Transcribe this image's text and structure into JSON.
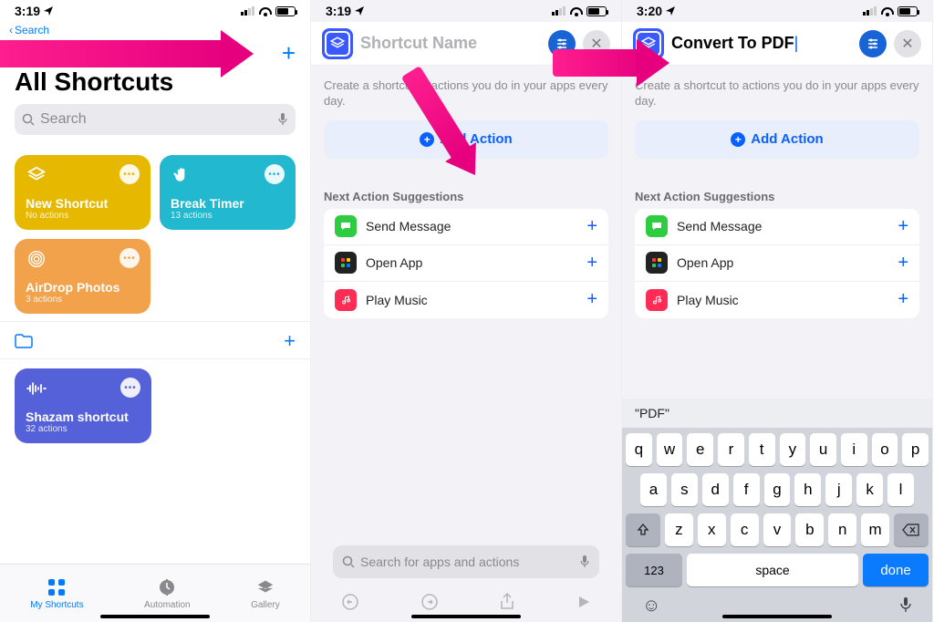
{
  "screens": {
    "s1": {
      "time": "3:19",
      "back": "Search",
      "title": "All Shortcuts",
      "searchPlaceholder": "Search",
      "tiles": [
        {
          "title": "New Shortcut",
          "sub": "No actions",
          "color": "#e6b800"
        },
        {
          "title": "Break Timer",
          "sub": "13 actions",
          "color": "#22b8cf"
        },
        {
          "title": "AirDrop Photos",
          "sub": "3 actions",
          "color": "#f2a24a"
        }
      ],
      "shazam": {
        "title": "Shazam shortcut",
        "sub": "32 actions",
        "color": "#5561d8"
      },
      "tabs": {
        "my": "My Shortcuts",
        "auto": "Automation",
        "gal": "Gallery"
      }
    },
    "s2": {
      "time": "3:19",
      "namePlaceholder": "Shortcut Name",
      "helper": "Create a shortcut to actions you do in your apps every day.",
      "addAction": "Add Action",
      "sugTitle": "Next Action Suggestions",
      "suggestions": [
        "Send Message",
        "Open App",
        "Play Music"
      ],
      "searchPlaceholder": "Search for apps and actions"
    },
    "s3": {
      "time": "3:20",
      "name": "Convert To PDF",
      "helper": "Create a shortcut to actions you do in your apps every day.",
      "addAction": "Add Action",
      "sugTitle": "Next Action Suggestions",
      "suggestions": [
        "Send Message",
        "Open App",
        "Play Music"
      ],
      "kbdSuggestion": "\"PDF\"",
      "keys": {
        "r1": [
          "q",
          "w",
          "e",
          "r",
          "t",
          "y",
          "u",
          "i",
          "o",
          "p"
        ],
        "r2": [
          "a",
          "s",
          "d",
          "f",
          "g",
          "h",
          "j",
          "k",
          "l"
        ],
        "r3": [
          "z",
          "x",
          "c",
          "v",
          "b",
          "n",
          "m"
        ],
        "k123": "123",
        "space": "space",
        "done": "done"
      }
    }
  }
}
